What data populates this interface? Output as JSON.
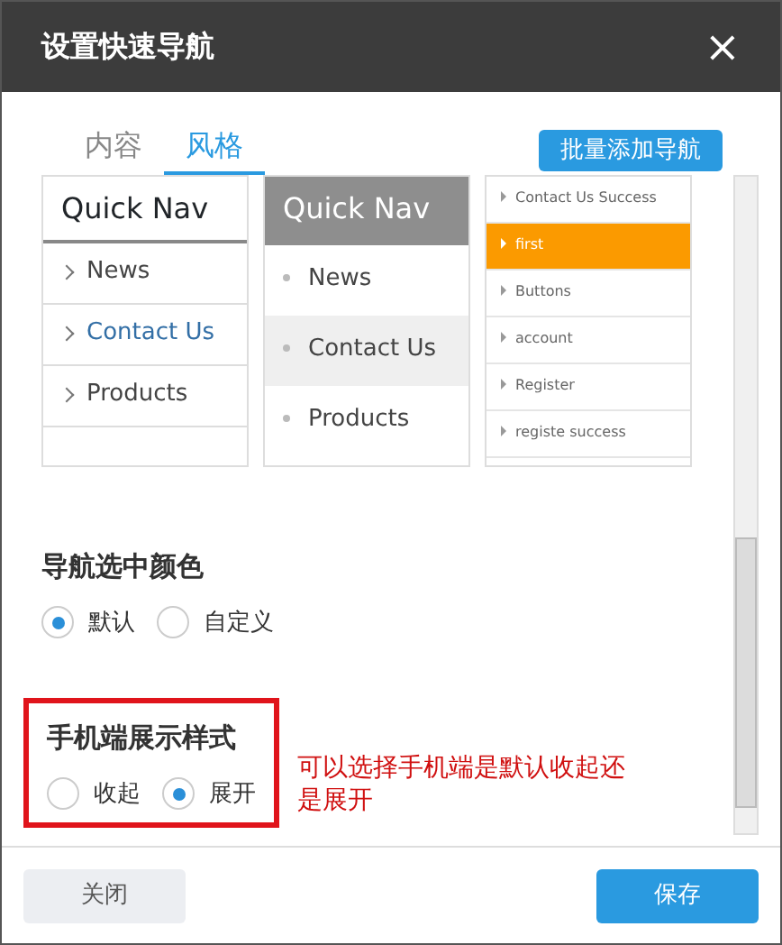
{
  "window": {
    "title": "设置快速导航",
    "close": "×"
  },
  "tabs": [
    {
      "label": "内容",
      "selected": false
    },
    {
      "label": "风格",
      "selected": true
    }
  ],
  "batch_button": "批量添加导航",
  "styles": [
    {
      "kind": "chevron",
      "title": "Quick Nav",
      "items": [
        {
          "label": "News",
          "selected": false
        },
        {
          "label": "Contact Us",
          "selected": true
        },
        {
          "label": "Products",
          "selected": false
        }
      ]
    },
    {
      "kind": "dot",
      "title": "Quick Nav",
      "items": [
        {
          "label": "News",
          "selected": false
        },
        {
          "label": "Contact Us",
          "selected": true
        },
        {
          "label": "Products",
          "selected": false
        }
      ]
    },
    {
      "kind": "compact",
      "items": [
        {
          "label": "Contact Us Success",
          "selected": false
        },
        {
          "label": "first",
          "selected": true
        },
        {
          "label": "Buttons",
          "selected": false
        },
        {
          "label": "account",
          "selected": false
        },
        {
          "label": "Register",
          "selected": false
        },
        {
          "label": "registe success",
          "selected": false
        }
      ]
    }
  ],
  "sections": [
    {
      "title": "导航选中颜色",
      "highlighted": false,
      "options": [
        {
          "label": "默认",
          "selected": true
        },
        {
          "label": "自定义",
          "selected": false
        }
      ]
    },
    {
      "title": "手机端展示样式",
      "highlighted": true,
      "options": [
        {
          "label": "收起",
          "selected": false
        },
        {
          "label": "展开",
          "selected": true
        }
      ],
      "note": "可以选择手机端是默认收起还是展开"
    }
  ],
  "footer": {
    "close_button": "关闭",
    "save_button": "保存"
  }
}
